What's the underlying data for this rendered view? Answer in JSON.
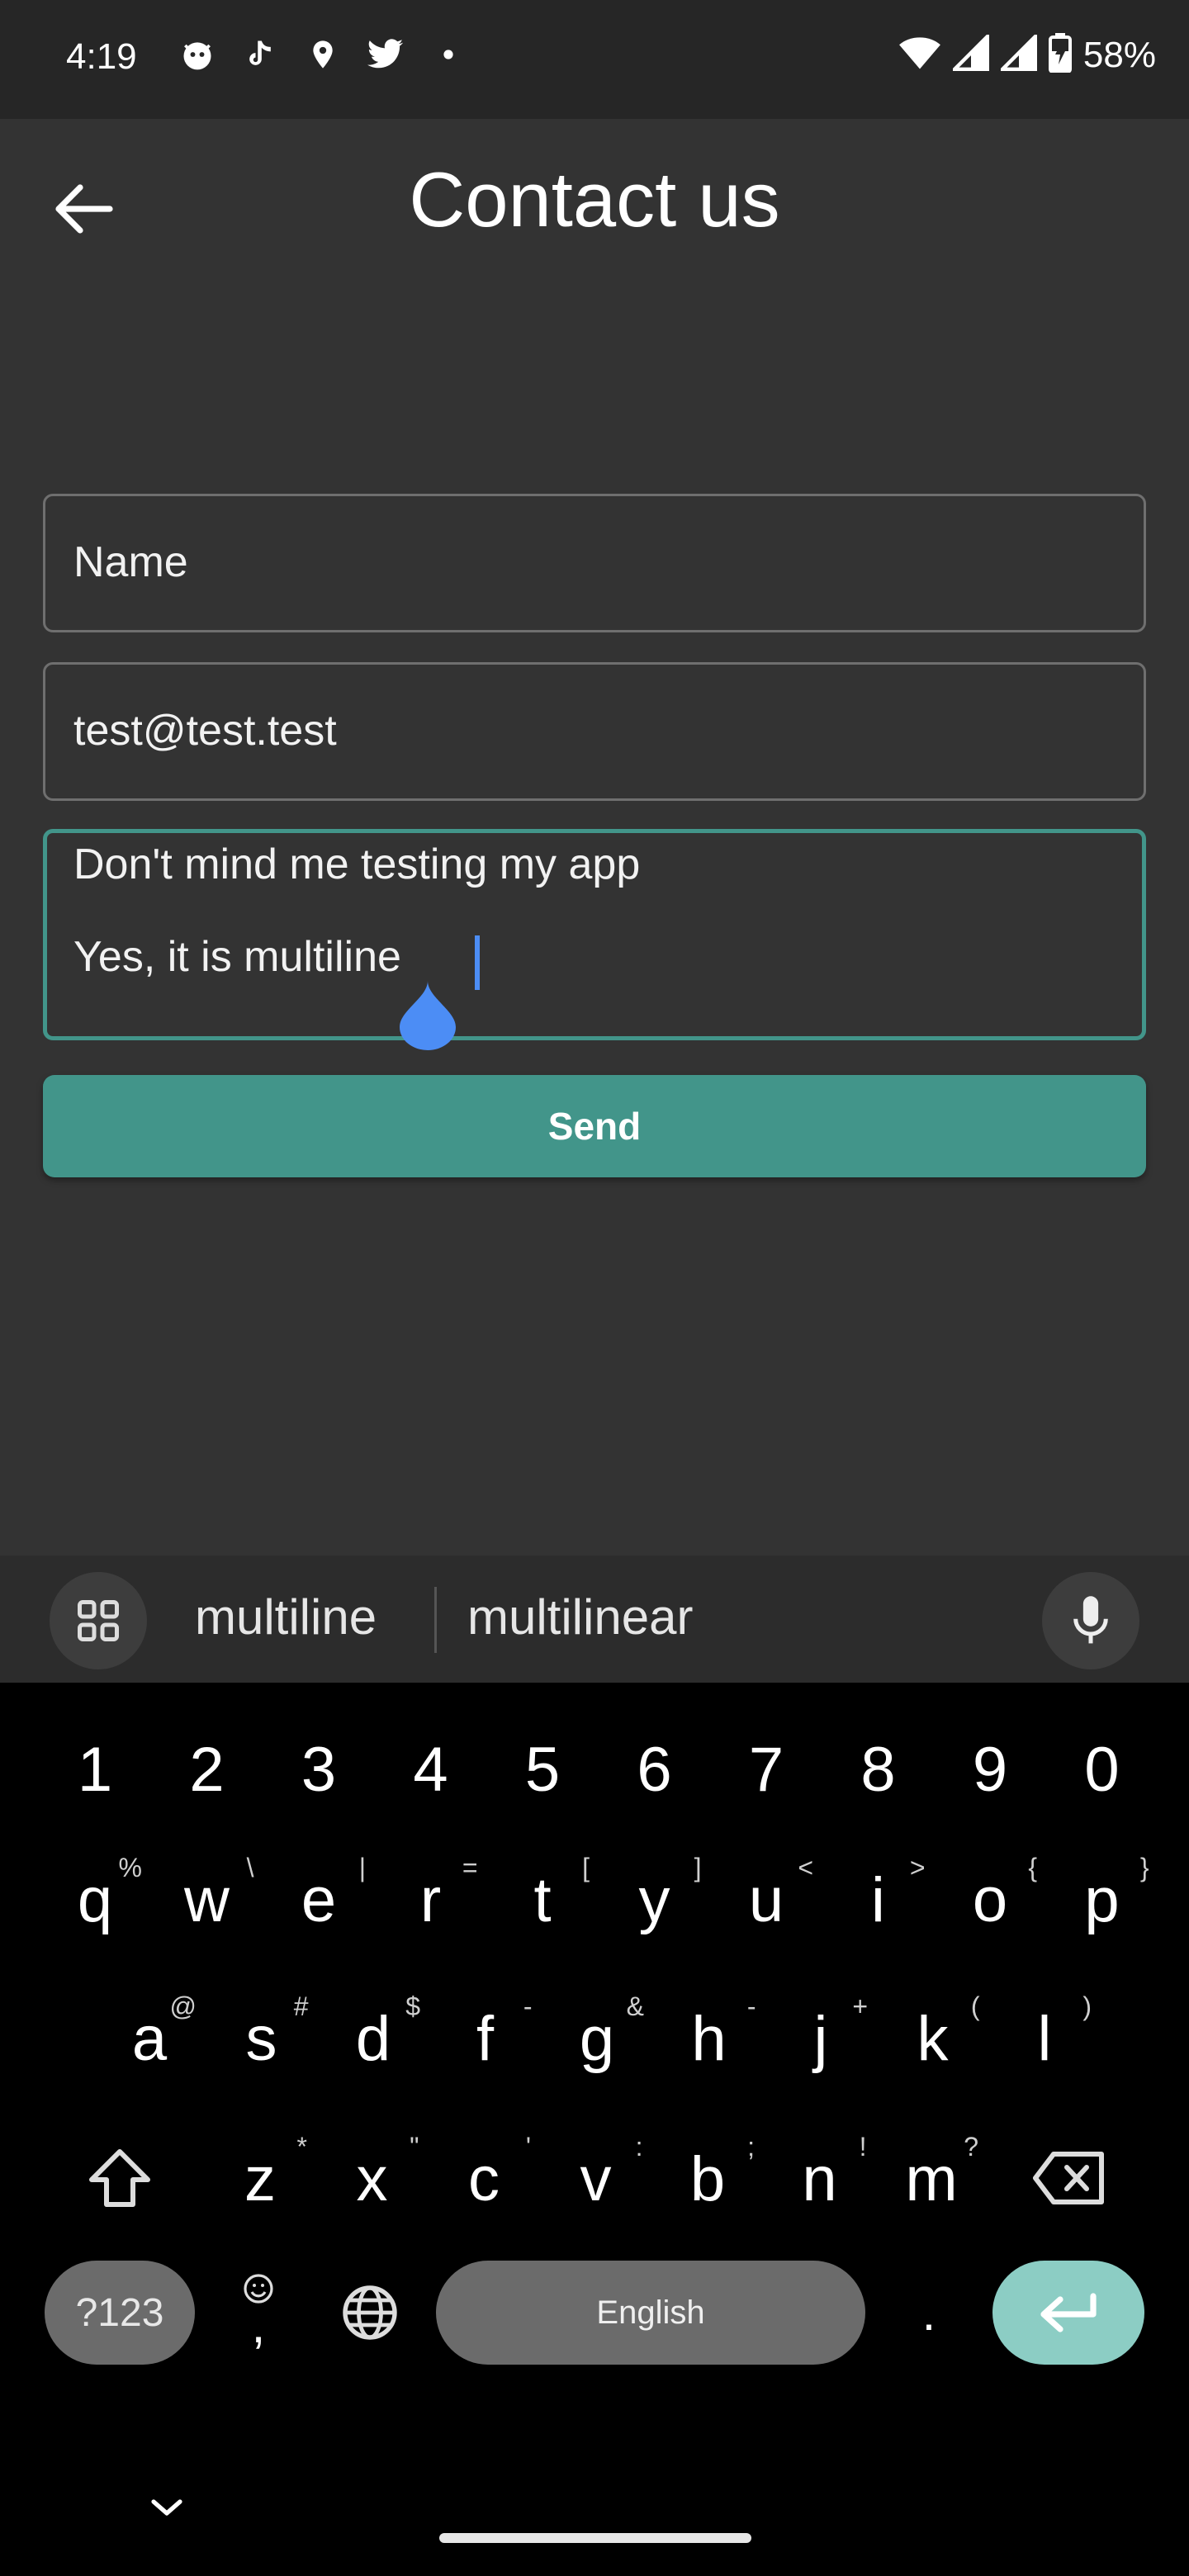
{
  "status_bar": {
    "time": "4:19",
    "battery": "58%",
    "left_icons": [
      "cat-icon",
      "tiktok-icon",
      "location-icon",
      "twitter-icon",
      "dot-icon"
    ],
    "right_icons": [
      "wifi-icon",
      "signal-icon",
      "signal-icon",
      "battery-charging-icon"
    ]
  },
  "app_bar": {
    "title": "Contact us",
    "back_icon": "arrow-left-icon"
  },
  "form": {
    "name_placeholder": "Name",
    "email_value": "test@test.test",
    "message_line1": "Don't mind me testing my app",
    "message_line2": "Yes, it is multiline",
    "send_label": "Send"
  },
  "keyboard": {
    "suggestions": [
      "multiline",
      "multilinear"
    ],
    "numbers": [
      "1",
      "2",
      "3",
      "4",
      "5",
      "6",
      "7",
      "8",
      "9",
      "0"
    ],
    "row1": [
      {
        "k": "q",
        "s": "%"
      },
      {
        "k": "w",
        "s": "\\"
      },
      {
        "k": "e",
        "s": "|"
      },
      {
        "k": "r",
        "s": "="
      },
      {
        "k": "t",
        "s": "["
      },
      {
        "k": "y",
        "s": "]"
      },
      {
        "k": "u",
        "s": "<"
      },
      {
        "k": "i",
        "s": ">"
      },
      {
        "k": "o",
        "s": "{"
      },
      {
        "k": "p",
        "s": "}"
      }
    ],
    "row2": [
      {
        "k": "a",
        "s": "@"
      },
      {
        "k": "s",
        "s": "#"
      },
      {
        "k": "d",
        "s": "$"
      },
      {
        "k": "f",
        "s": "-"
      },
      {
        "k": "g",
        "s": "&"
      },
      {
        "k": "h",
        "s": "-"
      },
      {
        "k": "j",
        "s": "+"
      },
      {
        "k": "k",
        "s": "("
      },
      {
        "k": "l",
        "s": ")"
      }
    ],
    "row3": [
      {
        "k": "z",
        "s": "*"
      },
      {
        "k": "x",
        "s": "\""
      },
      {
        "k": "c",
        "s": "'"
      },
      {
        "k": "v",
        "s": ":"
      },
      {
        "k": "b",
        "s": ";"
      },
      {
        "k": "n",
        "s": "!"
      },
      {
        "k": "m",
        "s": "?"
      }
    ],
    "symbols_label": "?123",
    "emoji_comma": ",",
    "space_label": "English",
    "period": ".",
    "accent_color": "#42958a",
    "enter_color": "#8ccdc4"
  }
}
